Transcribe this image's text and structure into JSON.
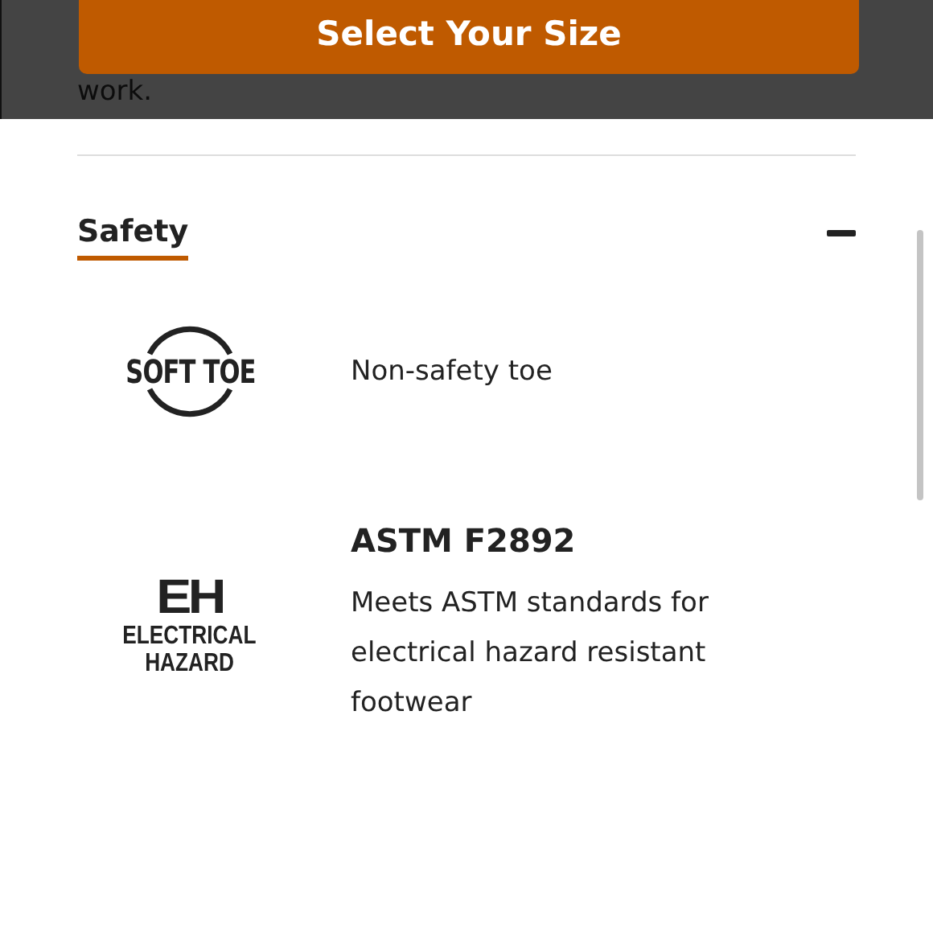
{
  "page_text": "work.",
  "sticky_bar": {
    "button": "Select Your Size"
  },
  "section": {
    "title": "Safety",
    "expanded": true
  },
  "features": [
    {
      "kind": "soft-toe",
      "badge": [
        "SOFT TOE"
      ],
      "description": "Non-safety toe"
    },
    {
      "kind": "electrical-hazard",
      "badge": [
        "EH",
        "ELECTRICAL",
        "HAZARD"
      ],
      "heading": "ASTM F2892",
      "description": "Meets ASTM standards for electrical hazard resistant footwear"
    }
  ]
}
